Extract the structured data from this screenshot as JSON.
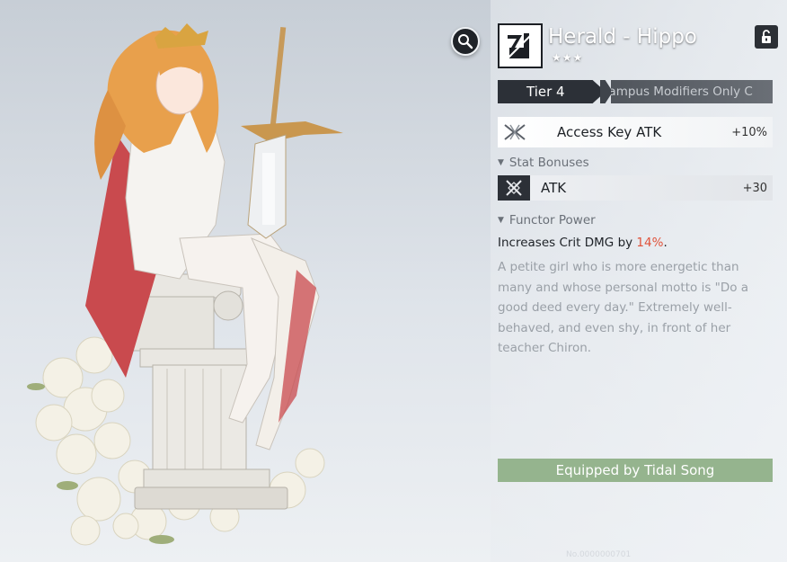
{
  "character": {
    "name": "Herald - Hippo",
    "stars": "★★★"
  },
  "tier": {
    "label": "Tier 4",
    "modifiers_text": "Campus Modifiers Only  C"
  },
  "access_key": {
    "label": "Access Key ATK",
    "value": "+10%"
  },
  "stat_bonuses": {
    "title": "Stat Bonuses",
    "items": [
      {
        "label": "ATK",
        "value": "+30"
      }
    ]
  },
  "functor_power": {
    "title": "Functor Power",
    "prefix": "Increases Crit DMG by ",
    "highlight": "14%",
    "suffix": "."
  },
  "lore": "A petite girl who is more energetic than many and whose personal motto is \"Do a good deed every day.\" Extremely well-behaved, and even shy, in front of her teacher Chiron.",
  "equipped": "Equipped by Tidal Song",
  "footer_id": "No.0000000701",
  "icons": {
    "zoom": "magnifier-icon",
    "lock": "unlock-icon",
    "emblem": "herald-emblem-icon",
    "access": "access-key-icon",
    "atk": "atk-icon"
  },
  "colors": {
    "highlight": "#e0533b",
    "equipped_bg": "#95b48e",
    "dark_ui": "#2c3037"
  }
}
